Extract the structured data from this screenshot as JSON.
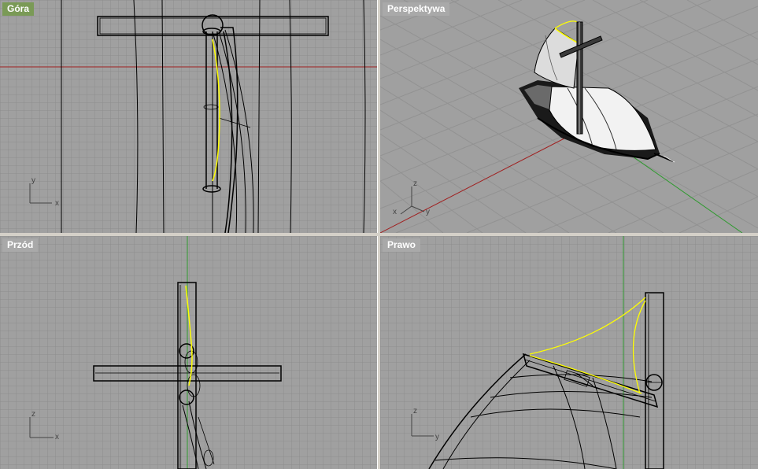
{
  "viewports": {
    "top": {
      "label": "Góra",
      "axes": {
        "vertical": "y",
        "horizontal": "x"
      }
    },
    "perspective": {
      "label": "Perspektywa",
      "axes": {
        "vertical": "z",
        "left": "x",
        "right": "y"
      }
    },
    "front": {
      "label": "Przód",
      "axes": {
        "vertical": "z",
        "horizontal": "x"
      }
    },
    "right": {
      "label": "Prawo",
      "axes": {
        "vertical": "z",
        "horizontal": "y"
      }
    }
  },
  "colors": {
    "viewport_bg": "#a0a0a0",
    "grid_line": "#8c8c8c",
    "grid_major": "#7a7a7a",
    "active_label_bg": "#7a9a56",
    "inactive_label_bg": "#a9a9a9",
    "x_axis": "#a02020",
    "y_axis": "#2f9a2f",
    "geometry": "#000000",
    "selected_curve": "#ffff00"
  }
}
